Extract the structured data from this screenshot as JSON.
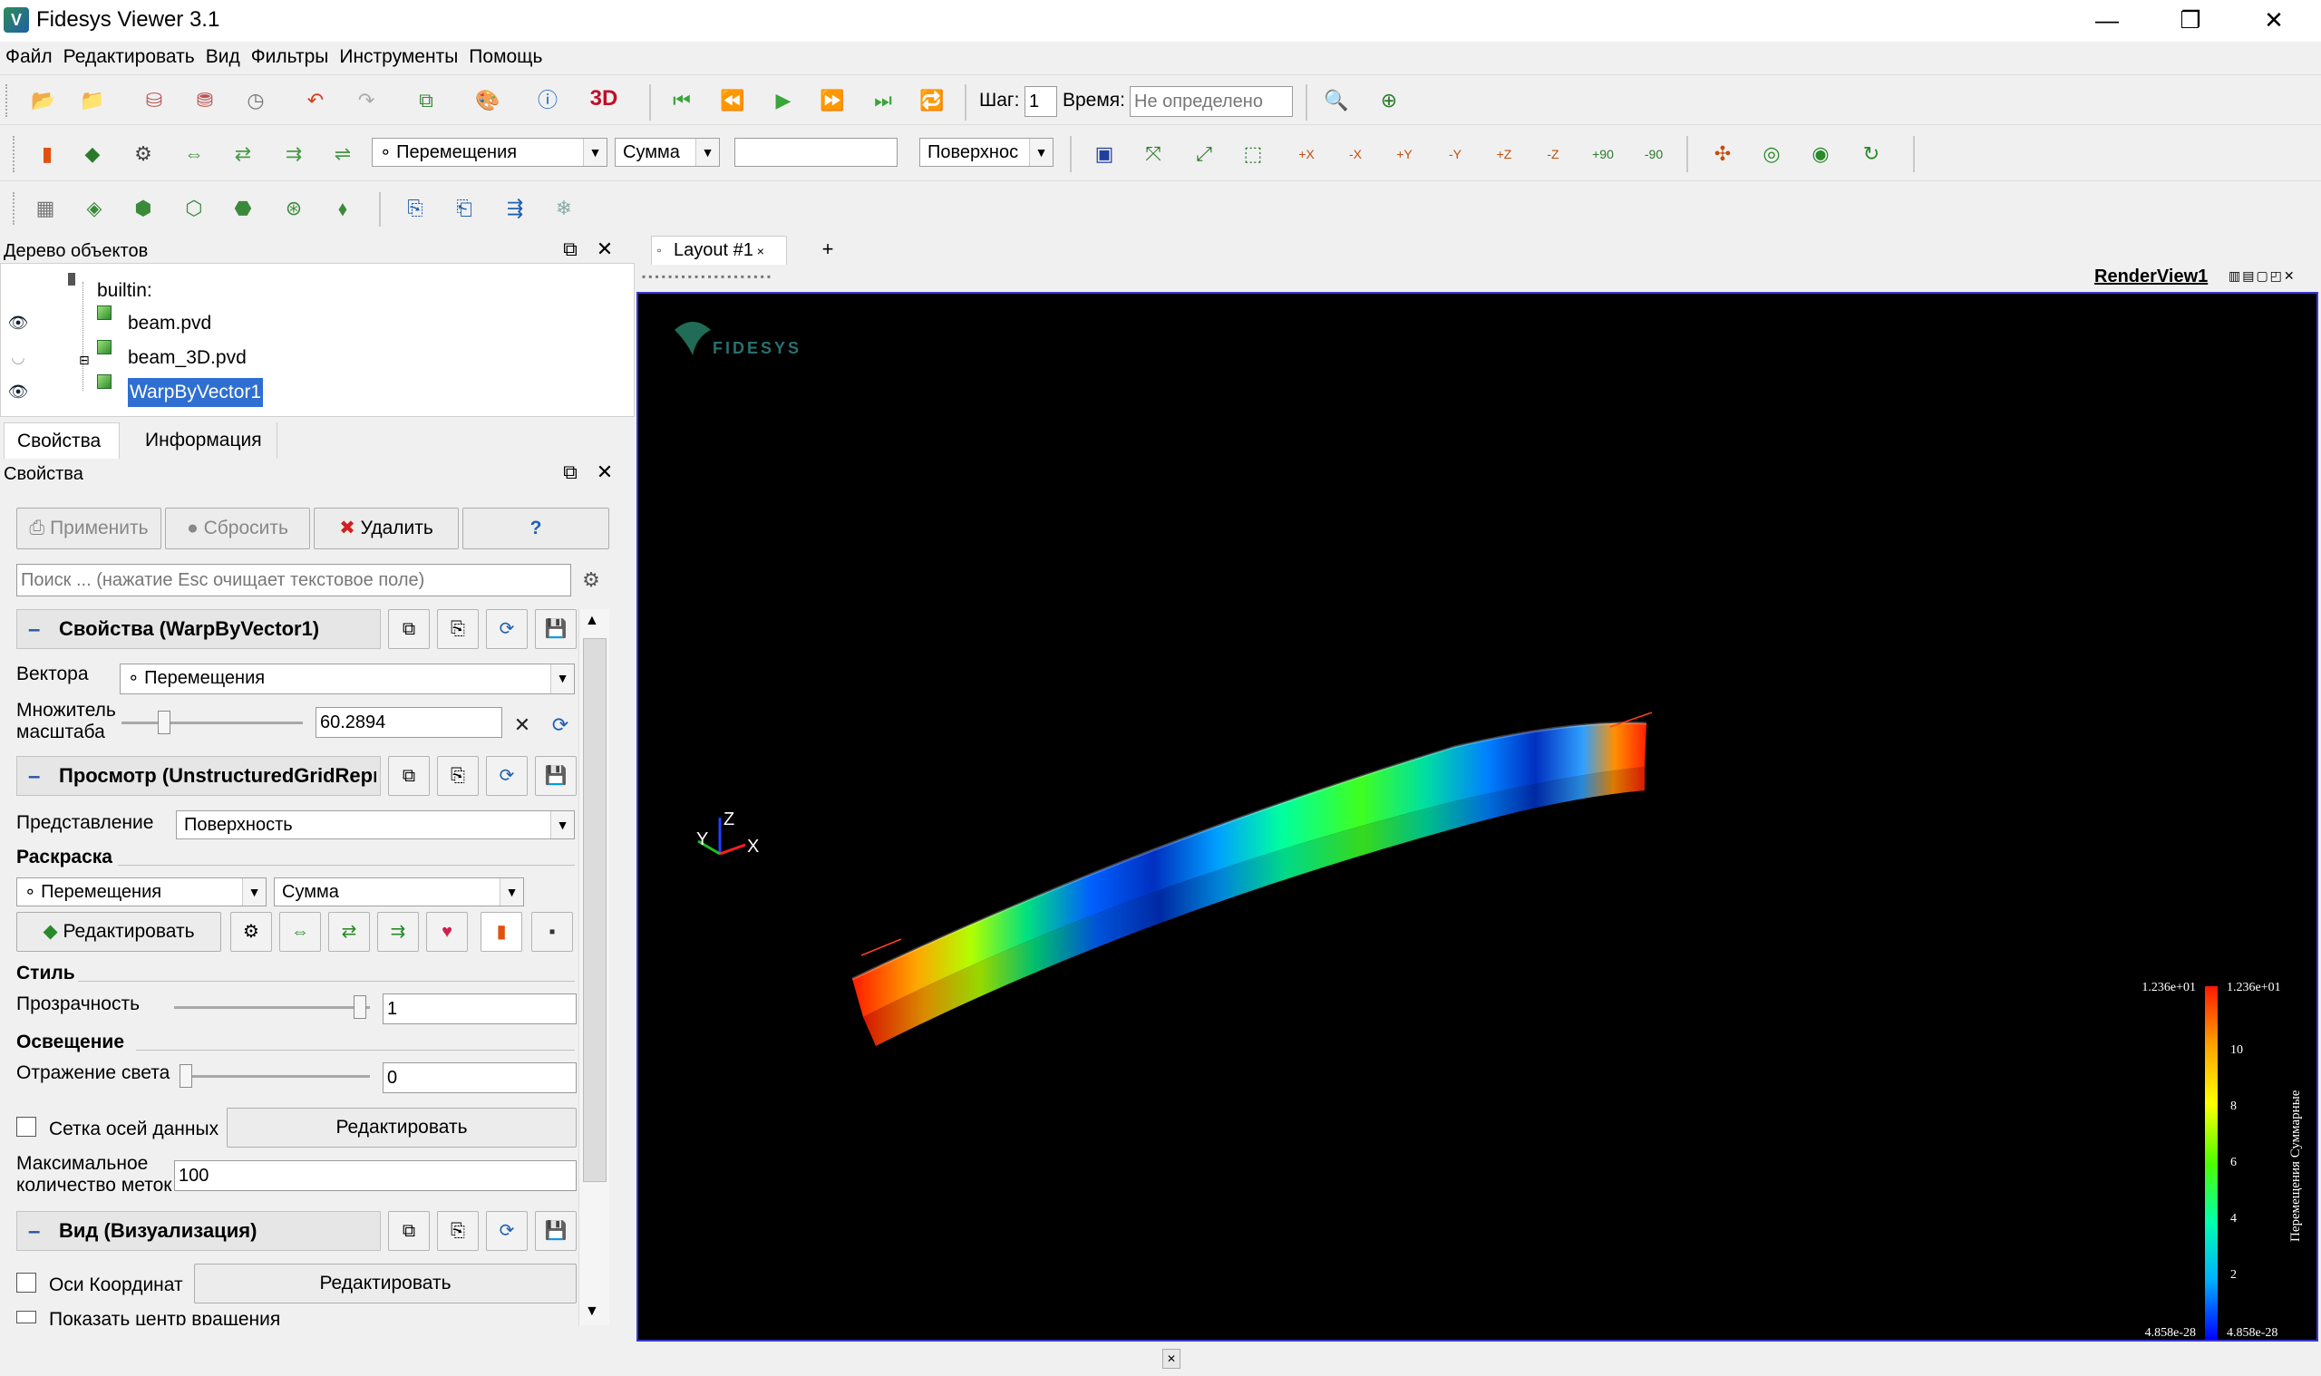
{
  "window": {
    "title": "Fidesys Viewer 3.1",
    "controls": [
      "—",
      "❐",
      "✕"
    ]
  },
  "menu": [
    "Файл",
    "Редактировать",
    "Вид",
    "Фильтры",
    "Инструменты",
    "Помощь"
  ],
  "toolbar1": {
    "step_label": "Шаг:",
    "step_value": "1",
    "time_label": "Время:",
    "time_placeholder": "Не определено"
  },
  "toolbar2": {
    "color_array": "Перемещения",
    "component": "Сумма",
    "representation": "Поверхнос",
    "camera_labels": [
      "+X",
      "-X",
      "+Y",
      "-Y",
      "+Z",
      "-Z",
      "+90",
      "-90"
    ]
  },
  "pipeline": {
    "title": "Дерево объектов",
    "items": [
      {
        "label": "builtin:"
      },
      {
        "label": "beam.pvd",
        "visible": true
      },
      {
        "label": "beam_3D.pvd",
        "visible": false
      },
      {
        "label": "WarpByVector1",
        "visible": true,
        "selected": true
      }
    ]
  },
  "tabs": [
    "Свойства",
    "Информация"
  ],
  "properties": {
    "title": "Свойства",
    "apply": "Применить",
    "reset": "Сбросить",
    "delete": "Удалить",
    "help": "?",
    "search_placeholder": "Поиск ... (нажатие Esc очищает текстовое поле)",
    "section_props": "Свойства (WarpByVector1)",
    "vectors_label": "Вектора",
    "vectors_value": "Перемещения",
    "scale_label_1": "Множитель",
    "scale_label_2": "масштаба",
    "scale_value": "60.2894",
    "section_display": "Просмотр (UnstructuredGridRepresentation)",
    "representation_label": "Представление",
    "representation_value": "Поверхность",
    "coloring_label": "Раскраска",
    "coloring_array": "Перемещения",
    "coloring_component": "Сумма",
    "edit_label": "Редактировать",
    "style_label": "Стиль",
    "opacity_label": "Прозрачность",
    "opacity_value": "1",
    "lighting_label": "Освещение",
    "specular_label": "Отражение света",
    "specular_value": "0",
    "data_axes_grid_label": "Сетка осей данных",
    "data_axes_edit": "Редактировать",
    "max_labels_1": "Максимальное",
    "max_labels_2": "количество меток",
    "max_labels_value": "100",
    "section_view": "Вид (Визуализация)",
    "orientation_axes_label": "Оси Координат",
    "orientation_axes_edit": "Редактировать",
    "show_center_label": "Показать центр вращения"
  },
  "layout": {
    "tab": "Layout #1",
    "add": "+",
    "view_name": "RenderView1"
  },
  "render": {
    "logo_text": "FIDESYS",
    "axes": {
      "x": "X",
      "y": "Y",
      "z": "Z"
    },
    "colorbar": {
      "title": "Перемещения Суммарные",
      "max_label": "1.236e+01",
      "min_label": "4.858e-28",
      "ticks": [
        "10",
        "8",
        "6",
        "4",
        "2"
      ],
      "colors": [
        "#ff1a00",
        "#ffa500",
        "#ffff00",
        "#4cff00",
        "#00ffb0",
        "#00b0ff",
        "#0000ff"
      ]
    }
  }
}
